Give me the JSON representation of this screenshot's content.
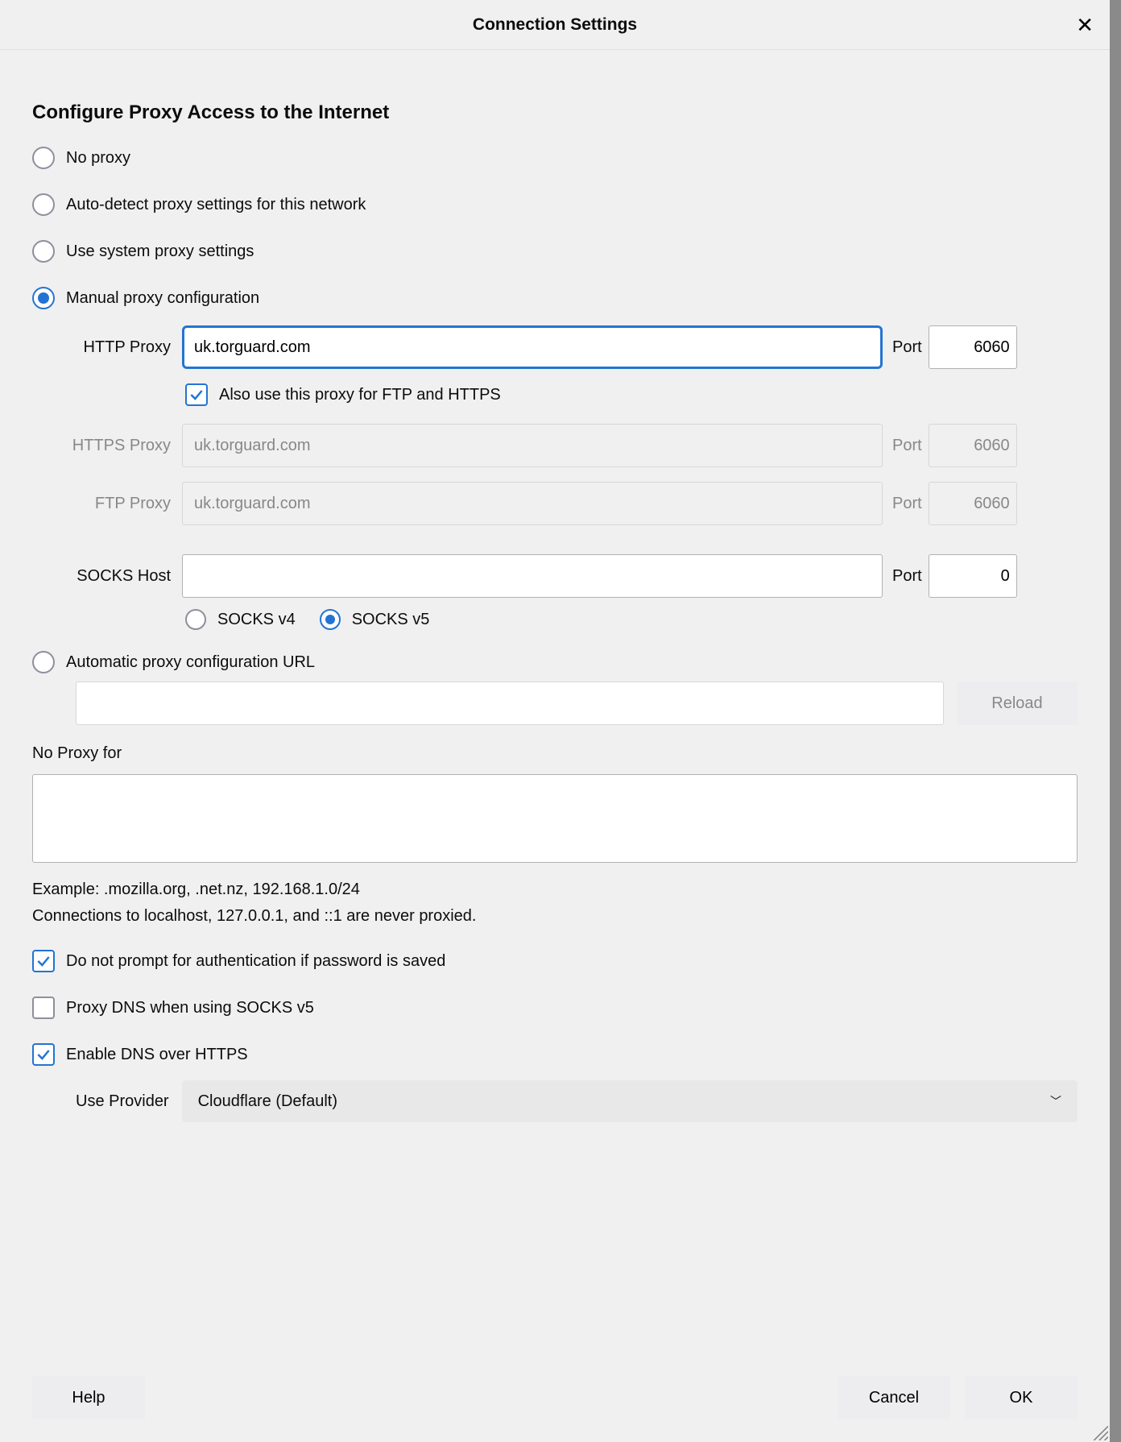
{
  "dialog": {
    "title": "Connection Settings"
  },
  "section": {
    "title": "Configure Proxy Access to the Internet"
  },
  "radios": {
    "no_proxy": "No proxy",
    "auto_detect": "Auto-detect proxy settings for this network",
    "system": "Use system proxy settings",
    "manual": "Manual proxy configuration",
    "auto_url": "Automatic proxy configuration URL"
  },
  "http": {
    "label": "HTTP Proxy",
    "host": "uk.torguard.com",
    "port_label": "Port",
    "port": "6060"
  },
  "also": {
    "label": "Also use this proxy for FTP and HTTPS"
  },
  "https": {
    "label": "HTTPS Proxy",
    "host": "uk.torguard.com",
    "port_label": "Port",
    "port": "6060"
  },
  "ftp": {
    "label": "FTP Proxy",
    "host": "uk.torguard.com",
    "port_label": "Port",
    "port": "6060"
  },
  "socks": {
    "label": "SOCKS Host",
    "host": "",
    "port_label": "Port",
    "port": "0",
    "v4": "SOCKS v4",
    "v5": "SOCKS v5"
  },
  "auto_url": {
    "value": "",
    "reload": "Reload"
  },
  "noproxy": {
    "label": "No Proxy for",
    "value": "",
    "example": "Example: .mozilla.org, .net.nz, 192.168.1.0/24",
    "note": "Connections to localhost, 127.0.0.1, and ::1 are never proxied."
  },
  "checks": {
    "auth": "Do not prompt for authentication if password is saved",
    "dns_socks": "Proxy DNS when using SOCKS v5",
    "doh": "Enable DNS over HTTPS"
  },
  "provider": {
    "label": "Use Provider",
    "value": "Cloudflare (Default)"
  },
  "buttons": {
    "help": "Help",
    "cancel": "Cancel",
    "ok": "OK"
  }
}
